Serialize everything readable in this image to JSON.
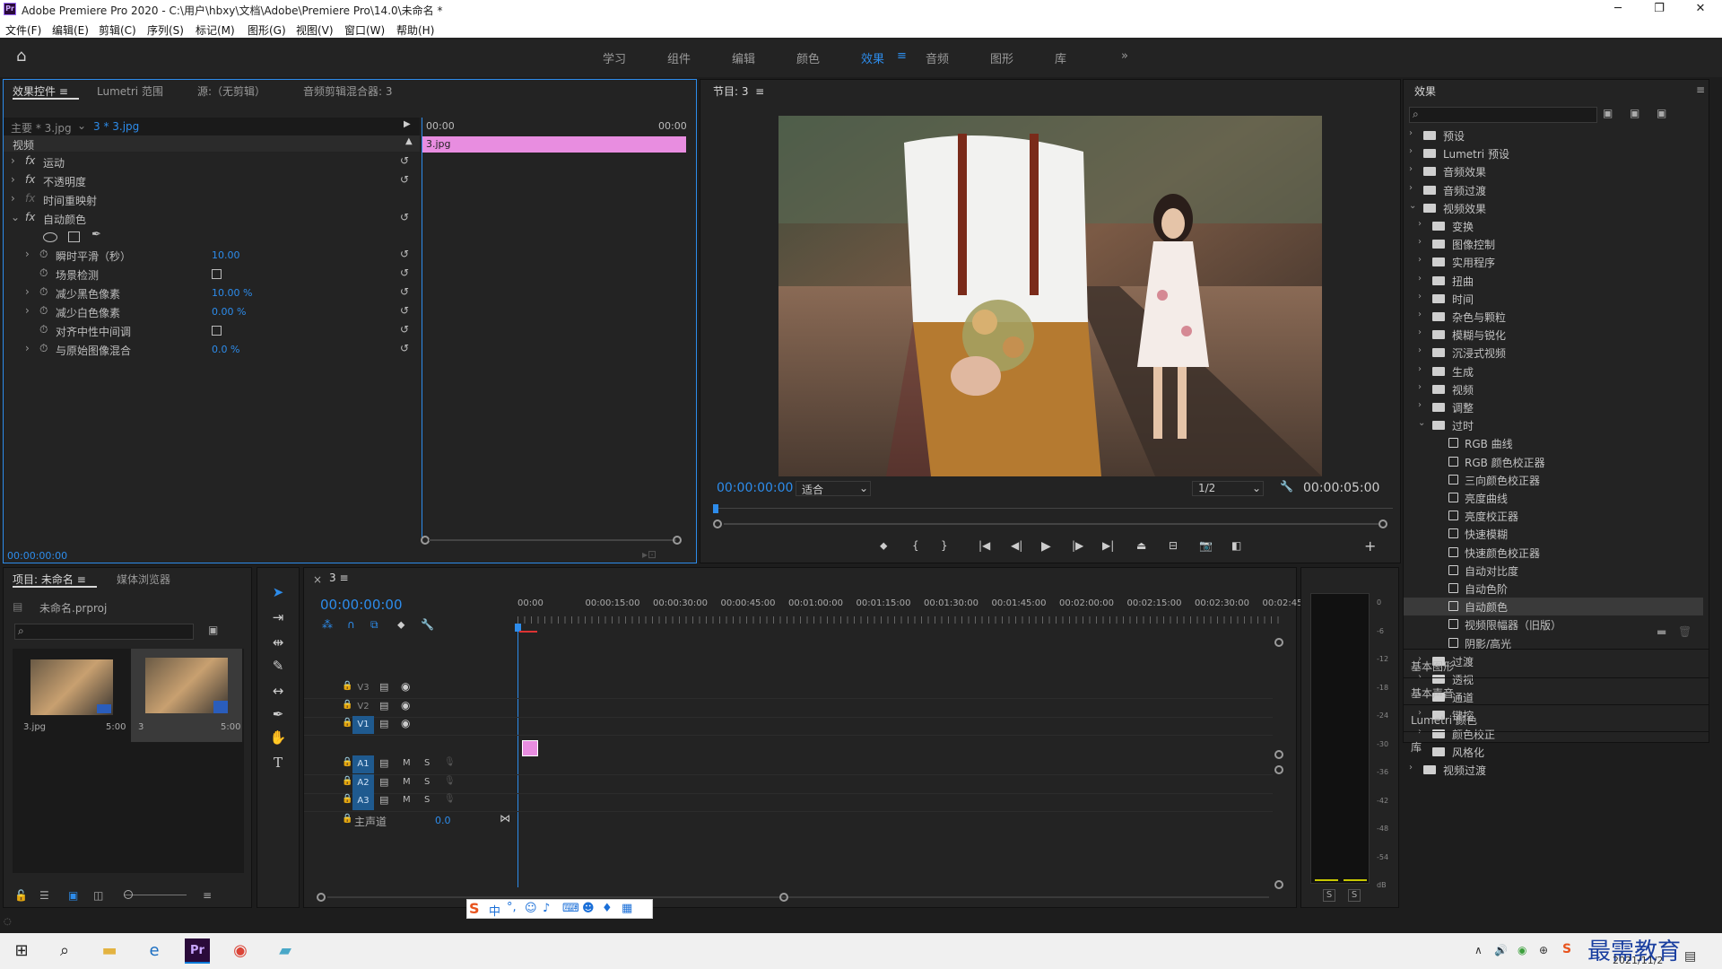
{
  "app": {
    "title": "Adobe Premiere Pro 2020 - C:\\用户\\hbxy\\文档\\Adobe\\Premiere Pro\\14.0\\未命名 *",
    "logo": "Pr",
    "win_min": "─",
    "win_max": "❐",
    "win_close": "✕"
  },
  "menu": [
    "文件(F)",
    "编辑(E)",
    "剪辑(C)",
    "序列(S)",
    "标记(M)",
    "图形(G)",
    "视图(V)",
    "窗口(W)",
    "帮助(H)"
  ],
  "workspaces": {
    "tabs": [
      "学习",
      "组件",
      "编辑",
      "颜色",
      "效果",
      "音频",
      "图形",
      "库"
    ],
    "active": "效果",
    "more": "»"
  },
  "effect_controls": {
    "tabs": [
      "效果控件",
      "Lumetri 范围",
      "源:（无剪辑）",
      "音频剪辑混合器: 3"
    ],
    "master_clip": "主要 * 3.jpg",
    "sequence_clip": "3 * 3.jpg",
    "time_start": "00:00",
    "time_end": "00:00",
    "clip_name": "3.jpg",
    "section_video": "视频",
    "rows": [
      {
        "label": "运动",
        "fx": true
      },
      {
        "label": "不透明度",
        "fx": true
      },
      {
        "label": "时间重映射",
        "fx": false
      },
      {
        "label": "自动颜色",
        "fx": true
      }
    ],
    "params": [
      {
        "label": "瞬时平滑（秒）",
        "value": "10.00",
        "type": "value"
      },
      {
        "label": "场景检测",
        "value": "",
        "type": "checkbox"
      },
      {
        "label": "减少黑色像素",
        "value": "10.00 %",
        "type": "value"
      },
      {
        "label": "减少白色像素",
        "value": "0.00 %",
        "type": "value"
      },
      {
        "label": "对齐中性中间调",
        "value": "",
        "type": "checkbox"
      },
      {
        "label": "与原始图像混合",
        "value": "0.0 %",
        "type": "value"
      }
    ],
    "timecode": "00:00:00:00"
  },
  "program": {
    "title": "节目: 3",
    "timecode": "00:00:00:00",
    "fit": "适合",
    "resolution": "1/2",
    "duration": "00:00:05:00"
  },
  "effects": {
    "title": "效果",
    "search_placeholder": "",
    "items": [
      {
        "label": "预设",
        "level": 0,
        "kind": "folder",
        "open": false
      },
      {
        "label": "Lumetri 预设",
        "level": 0,
        "kind": "folder",
        "open": false
      },
      {
        "label": "音频效果",
        "level": 0,
        "kind": "folder",
        "open": false
      },
      {
        "label": "音频过渡",
        "level": 0,
        "kind": "folder",
        "open": false
      },
      {
        "label": "视频效果",
        "level": 0,
        "kind": "folder",
        "open": true
      },
      {
        "label": "变换",
        "level": 1,
        "kind": "folder",
        "open": false
      },
      {
        "label": "图像控制",
        "level": 1,
        "kind": "folder",
        "open": false
      },
      {
        "label": "实用程序",
        "level": 1,
        "kind": "folder",
        "open": false
      },
      {
        "label": "扭曲",
        "level": 1,
        "kind": "folder",
        "open": false
      },
      {
        "label": "时间",
        "level": 1,
        "kind": "folder",
        "open": false
      },
      {
        "label": "杂色与颗粒",
        "level": 1,
        "kind": "folder",
        "open": false
      },
      {
        "label": "模糊与锐化",
        "level": 1,
        "kind": "folder",
        "open": false
      },
      {
        "label": "沉浸式视频",
        "level": 1,
        "kind": "folder",
        "open": false
      },
      {
        "label": "生成",
        "level": 1,
        "kind": "folder",
        "open": false
      },
      {
        "label": "视频",
        "level": 1,
        "kind": "folder",
        "open": false
      },
      {
        "label": "调整",
        "level": 1,
        "kind": "folder",
        "open": false
      },
      {
        "label": "过时",
        "level": 1,
        "kind": "folder",
        "open": true
      },
      {
        "label": "RGB 曲线",
        "level": 2,
        "kind": "effect"
      },
      {
        "label": "RGB 颜色校正器",
        "level": 2,
        "kind": "effect"
      },
      {
        "label": "三向颜色校正器",
        "level": 2,
        "kind": "effect"
      },
      {
        "label": "亮度曲线",
        "level": 2,
        "kind": "effect"
      },
      {
        "label": "亮度校正器",
        "level": 2,
        "kind": "effect"
      },
      {
        "label": "快速模糊",
        "level": 2,
        "kind": "effect"
      },
      {
        "label": "快速颜色校正器",
        "level": 2,
        "kind": "effect"
      },
      {
        "label": "自动对比度",
        "level": 2,
        "kind": "effect"
      },
      {
        "label": "自动色阶",
        "level": 2,
        "kind": "effect"
      },
      {
        "label": "自动颜色",
        "level": 2,
        "kind": "effect",
        "selected": true
      },
      {
        "label": "视频限幅器（旧版）",
        "level": 2,
        "kind": "effect"
      },
      {
        "label": "阴影/高光",
        "level": 2,
        "kind": "effect"
      },
      {
        "label": "过渡",
        "level": 1,
        "kind": "folder",
        "open": false
      },
      {
        "label": "透视",
        "level": 1,
        "kind": "folder",
        "open": false
      },
      {
        "label": "通道",
        "level": 1,
        "kind": "folder",
        "open": false
      },
      {
        "label": "键控",
        "level": 1,
        "kind": "folder",
        "open": false
      },
      {
        "label": "颜色校正",
        "level": 1,
        "kind": "folder",
        "open": false
      },
      {
        "label": "风格化",
        "level": 1,
        "kind": "folder",
        "open": false
      },
      {
        "label": "视频过渡",
        "level": 0,
        "kind": "folder",
        "open": false
      }
    ],
    "sections": [
      "基本图形",
      "基本声音",
      "Lumetri 颜色",
      "库"
    ]
  },
  "project": {
    "tabs": [
      "项目: 未命名",
      "媒体浏览器"
    ],
    "file": "未命名.prproj",
    "items": [
      {
        "name": "3.jpg",
        "duration": "5:00"
      },
      {
        "name": "3",
        "duration": "5:00"
      }
    ]
  },
  "timeline": {
    "tab": "3",
    "timecode": "00:00:00:00",
    "ruler": [
      "00:00",
      "00:00:15:00",
      "00:00:30:00",
      "00:00:45:00",
      "00:01:00:00",
      "00:01:15:00",
      "00:01:30:00",
      "00:01:45:00",
      "00:02:00:00",
      "00:02:15:00",
      "00:02:30:00",
      "00:02:45:"
    ],
    "video_tracks": [
      "V3",
      "V2",
      "V1"
    ],
    "audio_tracks": [
      "A1",
      "A2",
      "A3"
    ],
    "master": "主声道",
    "master_value": "0.0",
    "m_label": "M",
    "s_label": "S"
  },
  "meter": {
    "scale": [
      "0",
      "-6",
      "-12",
      "-18",
      "-24",
      "-30",
      "-36",
      "-42",
      "-48",
      "-54",
      "dB"
    ],
    "solo": "S"
  },
  "ime": {
    "items": [
      "中",
      "°,",
      "☺",
      "🎤",
      "⌨",
      "👤",
      "👕",
      "▦"
    ]
  },
  "taskbar": {
    "date": "2021/11/2",
    "watermark": "最需教育"
  },
  "colors": {
    "accent": "#2d8ceb",
    "clip": "#e88de0",
    "selected": "#3a3a3a"
  }
}
